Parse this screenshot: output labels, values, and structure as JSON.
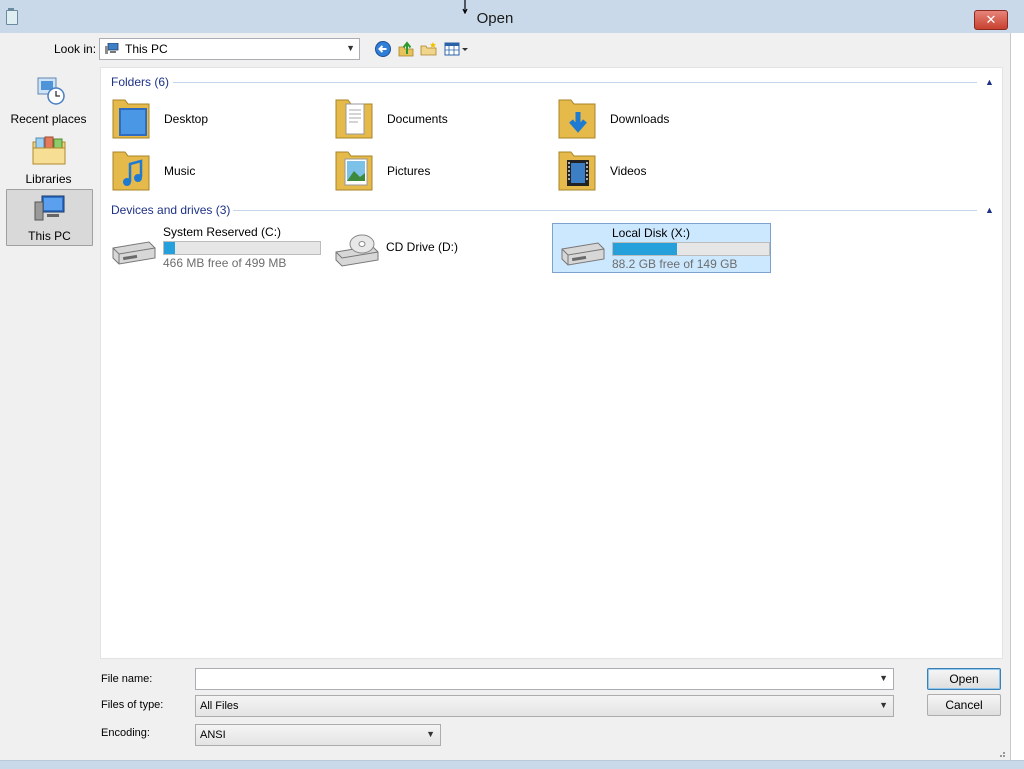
{
  "window": {
    "title": "Open",
    "close_label": "✕"
  },
  "toolbar": {
    "look_in_label": "Look in:",
    "look_in_value": "This PC"
  },
  "sidebar": {
    "items": [
      {
        "label": "Recent places",
        "icon": "recent-places-icon"
      },
      {
        "label": "Libraries",
        "icon": "libraries-icon"
      },
      {
        "label": "This PC",
        "icon": "computer-icon",
        "selected": true
      }
    ]
  },
  "folders": {
    "header": "Folders (6)",
    "items": [
      {
        "name": "Desktop",
        "icon": "desktop-folder-icon"
      },
      {
        "name": "Documents",
        "icon": "documents-folder-icon"
      },
      {
        "name": "Downloads",
        "icon": "downloads-folder-icon"
      },
      {
        "name": "Music",
        "icon": "music-folder-icon"
      },
      {
        "name": "Pictures",
        "icon": "pictures-folder-icon"
      },
      {
        "name": "Videos",
        "icon": "videos-folder-icon"
      }
    ]
  },
  "drives": {
    "header": "Devices and drives (3)",
    "items": [
      {
        "name": "System Reserved (C:)",
        "free_text": "466 MB free of 499 MB",
        "used_fraction": 0.07,
        "icon": "hard-drive-icon"
      },
      {
        "name": "CD Drive (D:)",
        "icon": "cd-drive-icon"
      },
      {
        "name": "Local Disk (X:)",
        "free_text": "88.2 GB free of 149 GB",
        "used_fraction": 0.41,
        "icon": "hard-drive-icon",
        "selected": true
      }
    ]
  },
  "form": {
    "file_name_label": "File name:",
    "file_name_value": "",
    "files_of_type_label": "Files of type:",
    "files_of_type_value": "All Files",
    "encoding_label": "Encoding:",
    "encoding_value": "ANSI"
  },
  "buttons": {
    "open": "Open",
    "cancel": "Cancel"
  },
  "colors": {
    "accent": "#26a0da",
    "group_header": "#1e3287",
    "selection": "#cce8ff"
  }
}
